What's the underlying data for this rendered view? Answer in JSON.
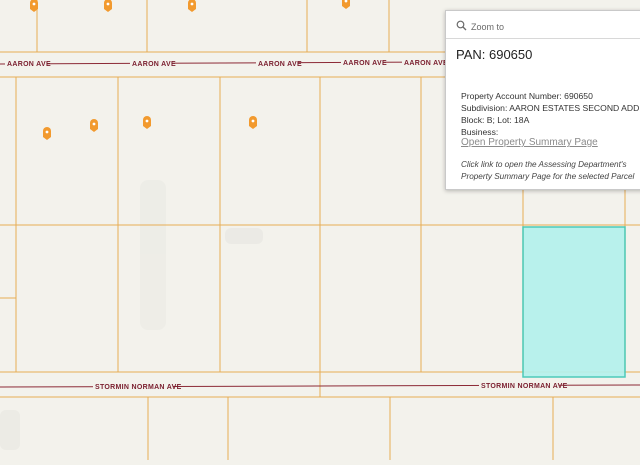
{
  "streets": {
    "top": "AARON AVE",
    "bottom": "STORMIN NORMAN AVE"
  },
  "colors": {
    "parcel_line": "#e7ad55",
    "road_line": "#8c2a36",
    "selected_parcel_fill": "#b3f1ec",
    "selected_parcel_stroke": "#3fc8b6",
    "marker": "#f29a2e"
  },
  "popup": {
    "zoom_label": "Zoom to",
    "title": "PAN: 690650",
    "account_line": "Property Account Number: 690650",
    "subdivision_line": "Subdivision: AARON ESTATES SECOND ADDITION",
    "block_lot_line": "Block: B;  Lot:  18A",
    "business_line": "Business:",
    "link_text": "Open Property Summary Page",
    "note_text": "Click link to open the Assessing Department's Property Summary Page for the selected Parcel"
  }
}
